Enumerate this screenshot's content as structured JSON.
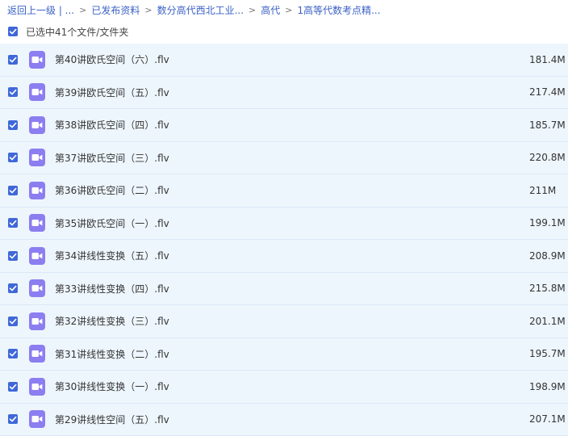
{
  "breadcrumb": {
    "items": [
      "返回上一级 | ...",
      "已发布资料",
      "数分高代西北工业...",
      "高代",
      "1高等代数考点精..."
    ],
    "separator": ">"
  },
  "selection": {
    "label": "已选中41个文件/文件夹"
  },
  "files": [
    {
      "name": "第40讲欧氏空间（六）.flv",
      "size": "181.4M"
    },
    {
      "name": "第39讲欧氏空间（五）.flv",
      "size": "217.4M"
    },
    {
      "name": "第38讲欧氏空间（四）.flv",
      "size": "185.7M"
    },
    {
      "name": "第37讲欧氏空间（三）.flv",
      "size": "220.8M"
    },
    {
      "name": "第36讲欧氏空间（二）.flv",
      "size": "211M"
    },
    {
      "name": "第35讲欧氏空间（一）.flv",
      "size": "199.1M"
    },
    {
      "name": "第34讲线性变换（五）.flv",
      "size": "208.9M"
    },
    {
      "name": "第33讲线性变换（四）.flv",
      "size": "215.8M"
    },
    {
      "name": "第32讲线性变换（三）.flv",
      "size": "201.1M"
    },
    {
      "name": "第31讲线性变换（二）.flv",
      "size": "195.7M"
    },
    {
      "name": "第30讲线性变换（一）.flv",
      "size": "198.9M"
    },
    {
      "name": "第29讲线性空间（五）.flv",
      "size": "207.1M"
    }
  ],
  "icons": {
    "checkbox": "checkbox-checked-icon",
    "file": "video-file-icon"
  },
  "colors": {
    "accent": "#3f68d8",
    "link": "#3b62c7",
    "row_bg": "#eef6fd",
    "video_icon": "#8c7ef0"
  }
}
